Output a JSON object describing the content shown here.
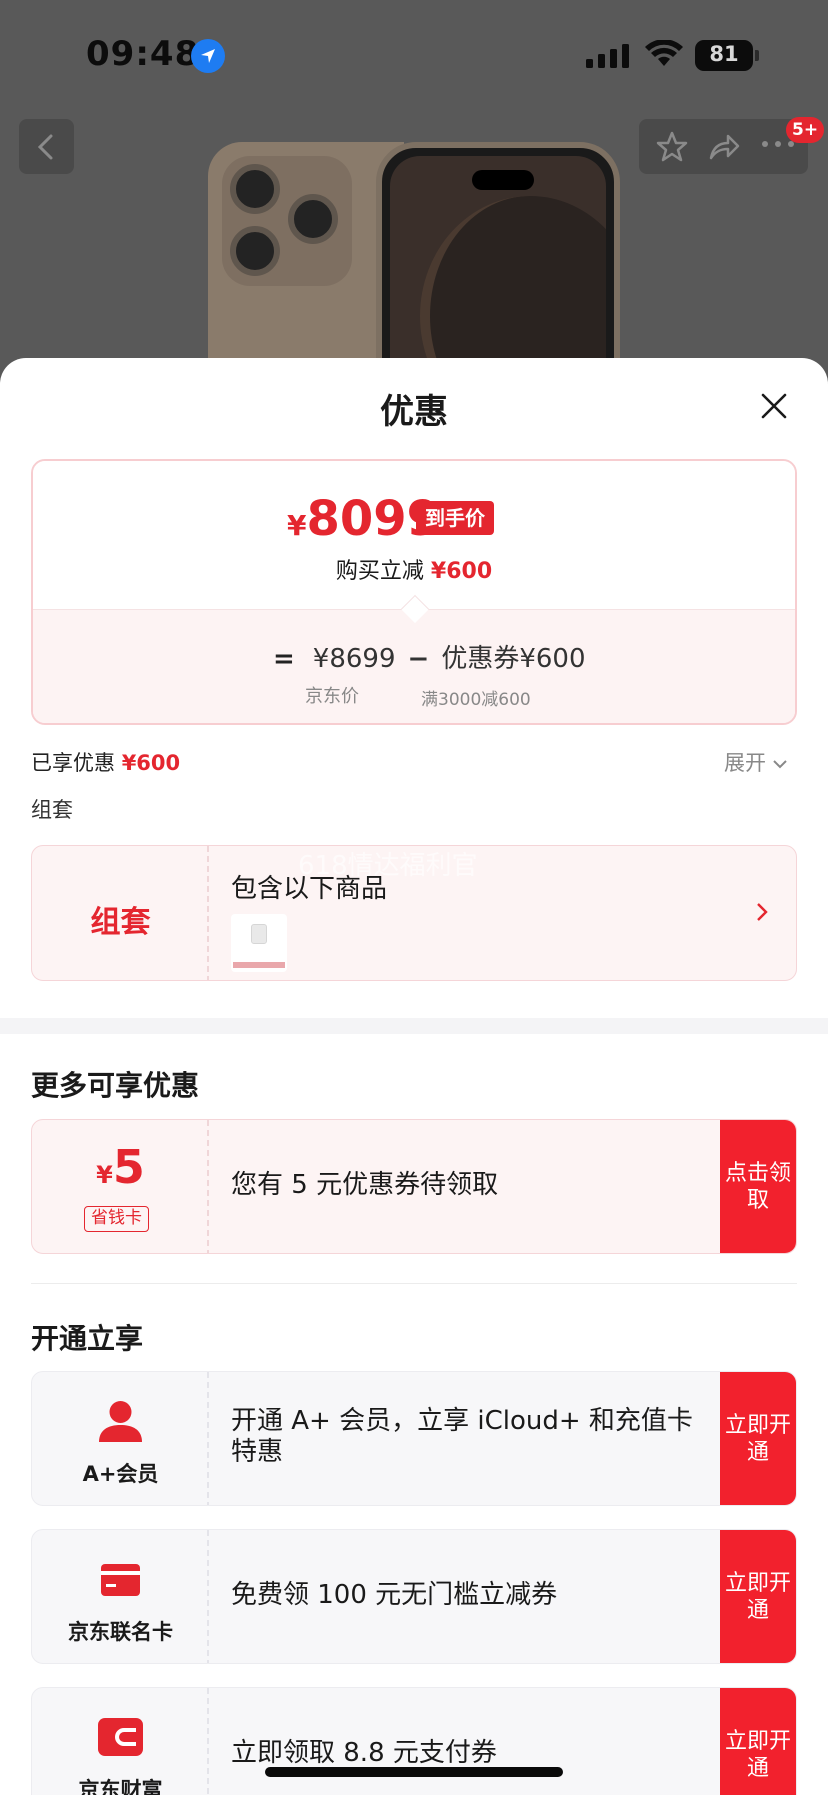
{
  "status_bar": {
    "time": "09:48",
    "battery": "81"
  },
  "nav": {
    "badge": "5+"
  },
  "sheet": {
    "title": "优惠"
  },
  "price": {
    "currency": "¥",
    "final": "8099",
    "final_tag": "到手价",
    "reduce_label": "购买立减",
    "reduce_amount": "¥600",
    "eq": "=",
    "jd_price": "¥8699",
    "minus": "−",
    "coupon_label": "优惠券",
    "coupon_value": "¥600",
    "jd_price_caption": "京东价",
    "coupon_caption": "满3000减600"
  },
  "enjoyed": {
    "label": "已享优惠",
    "amount": "¥600",
    "expand": "展开"
  },
  "bundle": {
    "section_label": "组套",
    "card_left": "组套",
    "card_text": "包含以下商品",
    "watermark": "618情达福利官"
  },
  "more_offers": {
    "title": "更多可享优惠",
    "coupon": {
      "currency": "¥",
      "amount": "5",
      "tag": "省钱卡",
      "text": "您有 5 元优惠券待领取",
      "cta": "点击领取"
    }
  },
  "open_enjoy": {
    "title": "开通立享",
    "items": [
      {
        "label": "A+会员",
        "text": "开通 A+ 会员，立享 iCloud+ 和充值卡特惠",
        "cta": "立即开通",
        "icon": "person-icon"
      },
      {
        "label": "京东联名卡",
        "text": "免费领 100 元无门槛立减券",
        "cta": "立即开通",
        "icon": "card-icon"
      },
      {
        "label": "京东财富",
        "text": "立即领取 8.8 元支付券",
        "cta": "立即开通",
        "icon": "wallet-icon"
      }
    ]
  },
  "colors": {
    "accent": "#e4262f",
    "cta": "#f2212d",
    "pink_bg": "#fdf4f4"
  }
}
